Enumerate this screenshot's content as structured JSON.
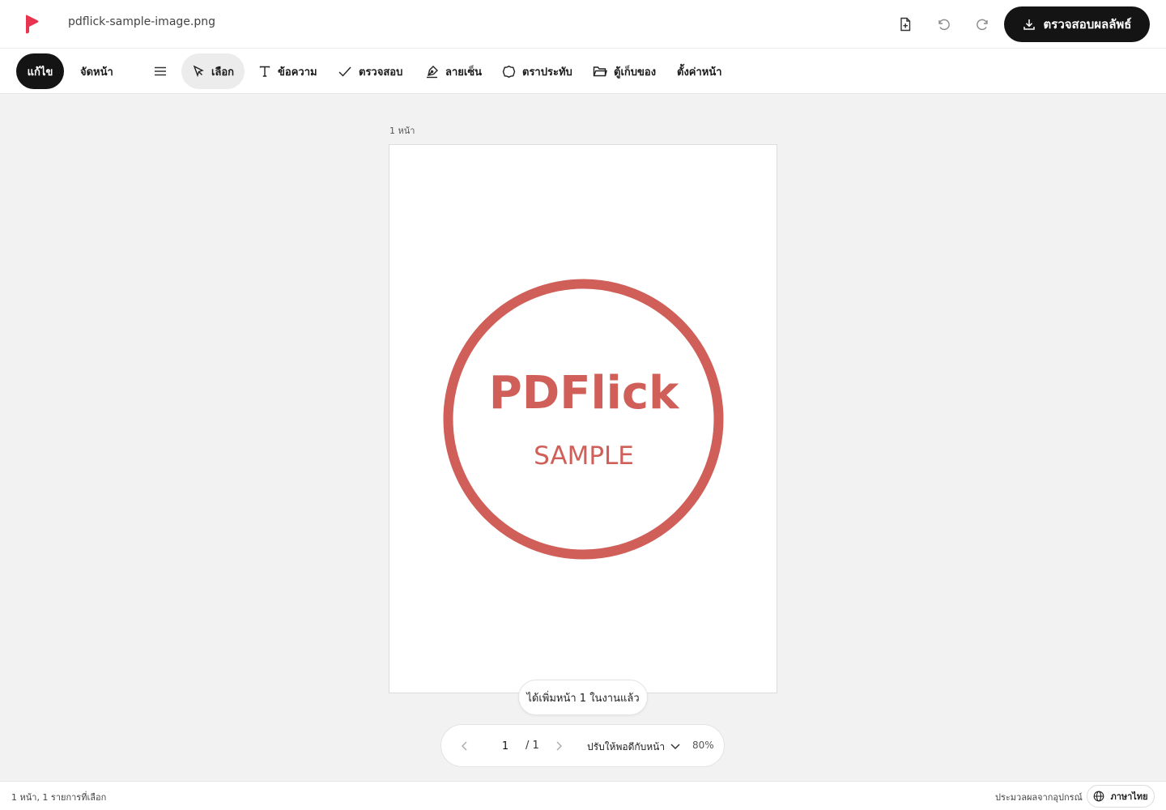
{
  "header": {
    "filename": "pdflick-sample-image.png",
    "export_label": "ตรวจสอบผลลัพธ์"
  },
  "toolbar": {
    "modes": [
      {
        "label": "แก้ไข",
        "active": true
      },
      {
        "label": "จัดหน้า",
        "active": false
      }
    ],
    "tools": [
      {
        "label": "เลือก",
        "icon": "cursor-icon",
        "active": true
      },
      {
        "label": "ข้อความ",
        "icon": "text-icon",
        "active": false
      },
      {
        "label": "ตรวจสอบ",
        "icon": "check-icon",
        "active": false
      },
      {
        "label": "ลายเซ็น",
        "icon": "pen-icon",
        "active": false
      },
      {
        "label": "ตราประทับ",
        "icon": "stamp-icon",
        "active": false
      },
      {
        "label": "ตู้เก็บของ",
        "icon": "folder-icon",
        "active": false
      },
      {
        "label": "ตั้งค่าหน้า",
        "icon": "",
        "active": false
      }
    ]
  },
  "canvas": {
    "page_count_label": "1 หน้า",
    "stamp": {
      "title": "PDFlick",
      "subtitle": "SAMPLE",
      "color": "#cf5f58"
    }
  },
  "toast": "ได้เพิ่มหน้า 1 ในงานแล้ว",
  "pager": {
    "current_page": "1",
    "total_label": "/ 1",
    "fit_label": "ปรับให้พอดีกับหน้า",
    "zoom": "80%"
  },
  "statusbar": {
    "selection": "1 หน้า, 1 รายการที่เลือก",
    "processing": "ประมวลผลจากอุปกรณ์",
    "language": "ภาษาไทย"
  },
  "colors": {
    "brand": "#e8344f",
    "primary_button": "#141414",
    "background": "#f2f2f2"
  }
}
